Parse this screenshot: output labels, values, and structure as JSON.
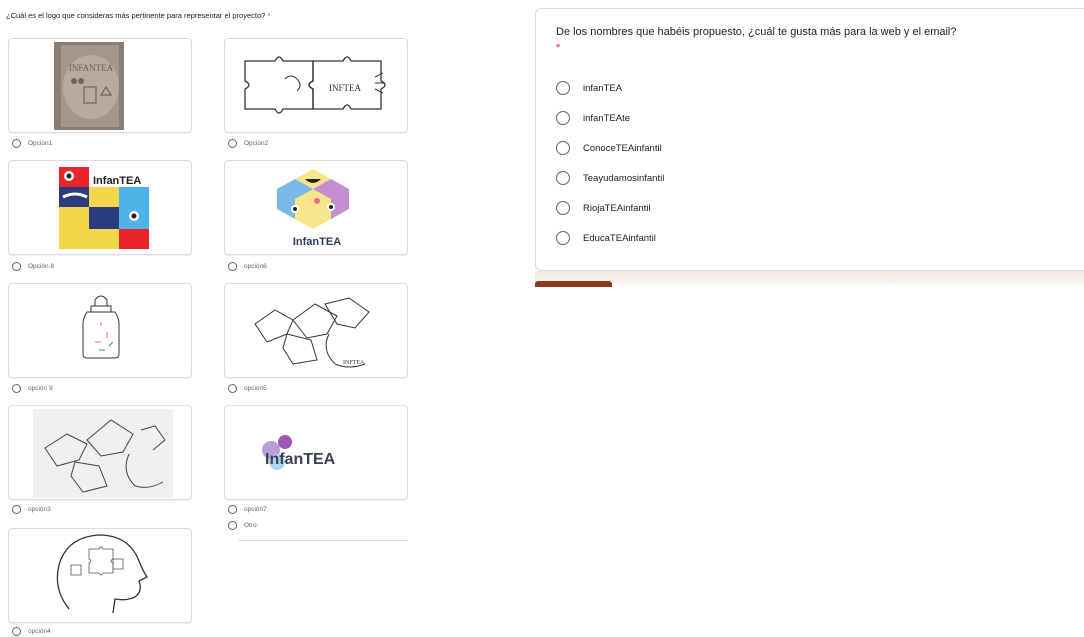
{
  "question1": {
    "title": "¿Cuál es el logo que consideras más pertinente para representar el proyecto?",
    "required_mark": "*",
    "options": [
      {
        "label": "Opción1"
      },
      {
        "label": "Opción2"
      },
      {
        "label": "Opción 8"
      },
      {
        "label": "opción6"
      },
      {
        "label": "opción 9"
      },
      {
        "label": "opción5"
      },
      {
        "label": "opción3"
      },
      {
        "label": "opción7"
      },
      {
        "label": "opción4"
      }
    ],
    "other_label": "Otro:",
    "logo_texts": {
      "logo8": "InfanTEA",
      "logo6": "InfanTEA",
      "logo7": "InfanTEA",
      "logo2": "INFTEA",
      "logo1": "INFANTEA"
    }
  },
  "question2": {
    "title": "De los nombres que habéis propuesto, ¿cuál te gusta más para la web y el email?",
    "required_mark": "*",
    "options": [
      "infanTEA",
      "infanTEAte",
      "ConoceTEAinfantil",
      "Teayudamosinfantil",
      "RiojaTEAinfantil",
      "EducaTEAinfantil"
    ]
  },
  "colors": {
    "accent": "#8b3a22",
    "required": "#d93025",
    "border": "#dadce0"
  }
}
